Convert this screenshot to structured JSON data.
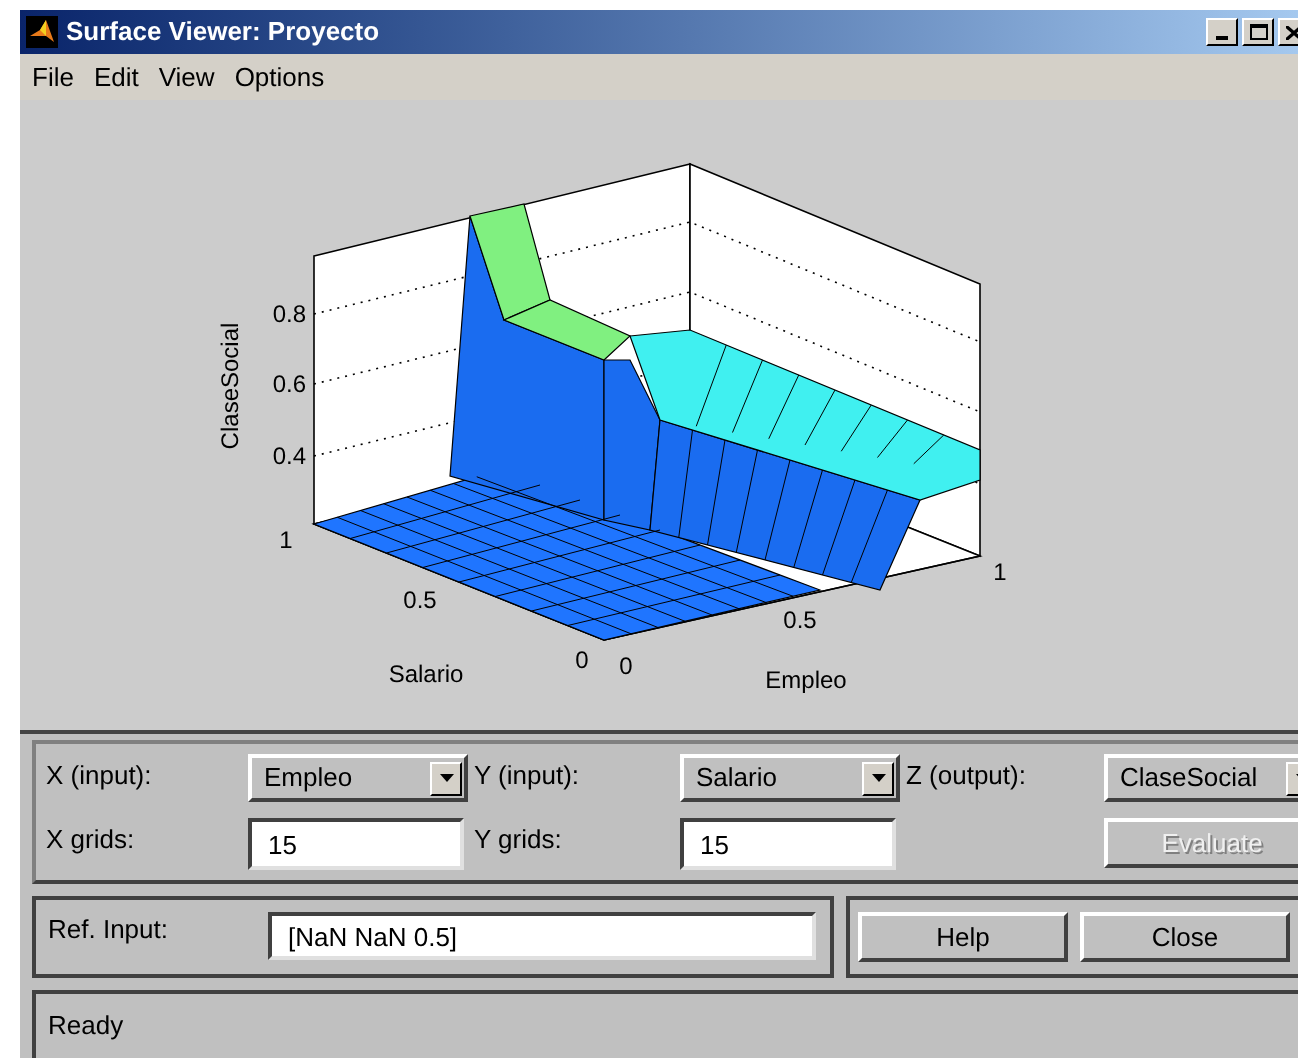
{
  "window": {
    "title": "Surface Viewer: Proyecto"
  },
  "menu": [
    "File",
    "Edit",
    "View",
    "Options"
  ],
  "plot": {
    "zlabel": "ClaseSocial",
    "ylabel": "Salario",
    "xlabel": "Empleo",
    "zticks": [
      "0.8",
      "0.6",
      "0.4"
    ],
    "yticks": [
      "1",
      "0.5",
      "0"
    ],
    "xticks": [
      "0",
      "0.5",
      "1"
    ]
  },
  "axes": [
    {
      "label": "X (input):",
      "value": "Empleo"
    },
    {
      "label": "Y (input):",
      "value": "Salario"
    },
    {
      "label": "Z (output):",
      "value": "ClaseSocial"
    }
  ],
  "grids": [
    {
      "label": "X grids:",
      "value": "15"
    },
    {
      "label": "Y grids:",
      "value": "15"
    }
  ],
  "evaluate": {
    "label": "Evaluate",
    "disabled": true
  },
  "ref_input": {
    "label": "Ref. Input:",
    "value": "[NaN NaN 0.5]"
  },
  "buttons": [
    "Help",
    "Close"
  ],
  "status_bar": "Ready"
}
